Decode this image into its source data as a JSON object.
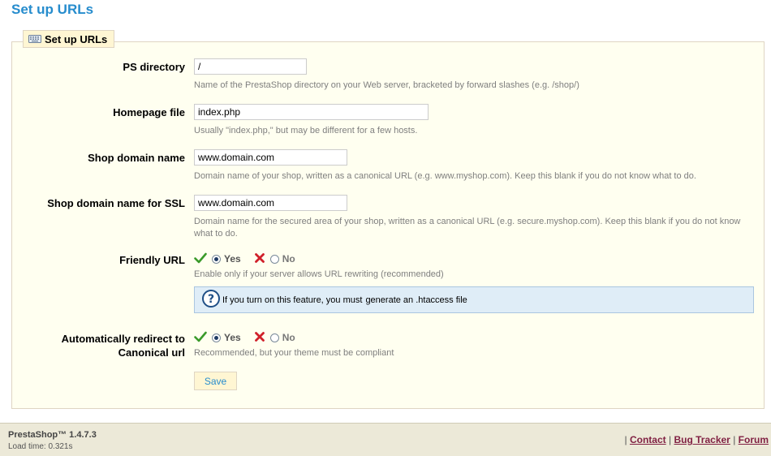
{
  "page": {
    "title": "Set up URLs"
  },
  "fieldset": {
    "legend": "Set up URLs"
  },
  "fields": {
    "ps_directory": {
      "label": "PS directory",
      "value": "/",
      "description": "Name of the PrestaShop directory on your Web server, bracketed by forward slashes (e.g. /shop/)"
    },
    "homepage_file": {
      "label": "Homepage file",
      "value": "index.php",
      "description": "Usually \"index.php,\" but may be different for a few hosts."
    },
    "shop_domain": {
      "label": "Shop domain name",
      "value": "www.domain.com",
      "description": "Domain name of your shop, written as a canonical URL (e.g. www.myshop.com). Keep this blank if you do not know what to do."
    },
    "shop_domain_ssl": {
      "label": "Shop domain name for SSL",
      "value": "www.domain.com",
      "description": "Domain name for the secured area of your shop, written as a canonical URL (e.g. secure.myshop.com). Keep this blank if you do not know what to do."
    },
    "friendly_url": {
      "label": "Friendly URL",
      "yes": "Yes",
      "no": "No",
      "selected": "Yes",
      "description": "Enable only if your server allows URL rewriting (recommended)",
      "hint_text": "If you turn on this feature, you must",
      "hint_link": "generate an .htaccess file"
    },
    "canonical_redirect": {
      "label_line1": "Automatically redirect to",
      "label_line2": "Canonical url",
      "yes": "Yes",
      "no": "No",
      "selected": "Yes",
      "description": "Recommended, but your theme must be compliant"
    }
  },
  "save_button": "Save",
  "footer": {
    "version": "PrestaShop™ 1.4.7.3",
    "load_time": "Load time: 0.321s",
    "separator": "|",
    "links": [
      "Contact",
      "Bug Tracker",
      "Forum"
    ]
  },
  "colors": {
    "title": "#268ccd",
    "fieldset_bg": "#fffff0",
    "legend_bg": "#fff6d3",
    "hint_bg": "#dfedf7",
    "footer_bg": "#ece9d8",
    "footer_link": "#812143",
    "check": "#3a9a2a",
    "cross": "#d0202a"
  },
  "icons": {
    "legend": "keyboard-icon",
    "yes": "check-icon",
    "no": "cross-icon",
    "hint": "help-icon"
  }
}
